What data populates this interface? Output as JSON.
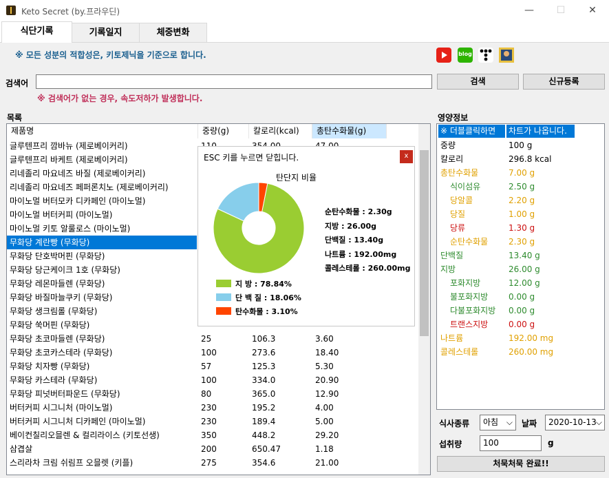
{
  "window": {
    "title": "Keto Secret (by.프라우딘)",
    "controls": {
      "minimize": "—",
      "maximize": "☐",
      "close": "✕"
    }
  },
  "tabs": [
    {
      "label": "식단기록",
      "active": true
    },
    {
      "label": "기록일지",
      "active": false
    },
    {
      "label": "체중변화",
      "active": false
    }
  ],
  "notice": "※ 모든 성분의 적합성은, 키토제닉을 기준으로 합니다.",
  "social_icons": [
    "youtube-icon",
    "blog-icon",
    "tistory-icon",
    "user-photo-icon"
  ],
  "social": {
    "blog_label": "blog"
  },
  "search": {
    "label": "검색어",
    "value": "",
    "search_button": "검색",
    "register_button": "신규등록",
    "warning": "※ 검색어가 없는 경우, 속도저하가 발생합니다."
  },
  "list": {
    "title": "목록",
    "columns": [
      "제품명",
      "중량(g)",
      "칼로리(kcal)",
      "총탄수화물(g)"
    ],
    "sorted_column": 3,
    "selected_row": 7,
    "rows": [
      [
        "글루텐프리 깜바뉴 (제로베이커리)",
        "110",
        "354.00",
        "47.00"
      ],
      [
        "글루텐프리 바케트 (제로베이커리)",
        "",
        "",
        ""
      ],
      [
        "리네졸리 마요네즈 바질 (제로베이커리)",
        "",
        "",
        ""
      ],
      [
        "리네졸리 마요네즈 페퍼론치노 (제로베이커리)",
        "",
        "",
        ""
      ],
      [
        "마이노멀 버터모카 디카페인 (마이노멀)",
        "",
        "",
        ""
      ],
      [
        "마이노멀 버터커피 (마이노멀)",
        "",
        "",
        ""
      ],
      [
        "마이노멀 키토 알룰로스 (마이노멀)",
        "",
        "",
        ""
      ],
      [
        "무화당 계란빵 (무화당)",
        "",
        "",
        ""
      ],
      [
        "무화당 단호박머핀 (무화당)",
        "",
        "",
        ""
      ],
      [
        "무화당 당근케이크 1호 (무화당)",
        "",
        "",
        ""
      ],
      [
        "무화당 레몬마들렌 (무화당)",
        "",
        "",
        ""
      ],
      [
        "무화당 바질마늘쿠키 (무화당)",
        "",
        "",
        ""
      ],
      [
        "무화당 생크림롤 (무화당)",
        "",
        "",
        ""
      ],
      [
        "무화당 쑥머핀 (무화당)",
        "",
        "",
        ""
      ],
      [
        "무화당 초코마들렌 (무화당)",
        "25",
        "106.3",
        "3.60"
      ],
      [
        "무화당 초코카스테라 (무화당)",
        "100",
        "273.6",
        "18.40"
      ],
      [
        "무화당 치자빵 (무화당)",
        "57",
        "125.3",
        "5.30"
      ],
      [
        "무화당 카스테라 (무화당)",
        "100",
        "334.0",
        "20.90"
      ],
      [
        "무화당 피넛버터파운드 (무화당)",
        "80",
        "365.0",
        "12.90"
      ],
      [
        "버터커피 시그니처 (마이노멀)",
        "230",
        "195.2",
        "4.00"
      ],
      [
        "버터커피 시그니처 디카페인 (마이노멀)",
        "230",
        "189.4",
        "5.00"
      ],
      [
        "베이컨칠리오믈렌 & 컬리라이스 (키토선생)",
        "350",
        "448.2",
        "29.20"
      ],
      [
        "삼겹살",
        "200",
        "650.47",
        "1.18"
      ],
      [
        "스리라차 크림 쉬림프 오믈렛 (키플)",
        "275",
        "354.6",
        "21.00"
      ]
    ]
  },
  "popup": {
    "hint": "ESC 키를 누르면 닫힙니다.",
    "close": "x",
    "chart_title": "탄단지 비율",
    "info": [
      "순탄수화물 : 2.30g",
      "지방 : 26.00g",
      "단백질 : 13.40g",
      "나트륨 : 192.00mg",
      "콜레스테롤 : 260.00mg"
    ],
    "legend": [
      {
        "label": "지      방 : 78.84%",
        "color": "#9acd32"
      },
      {
        "label": "단  백  질 : 18.06%",
        "color": "#87ceeb"
      },
      {
        "label": "탄수화물 : 3.10%",
        "color": "#ff4500"
      }
    ]
  },
  "chart_data": {
    "type": "pie",
    "donut": true,
    "title": "탄단지 비율",
    "categories": [
      "지방",
      "단백질",
      "탄수화물"
    ],
    "values": [
      78.84,
      18.06,
      3.1
    ],
    "colors": [
      "#9acd32",
      "#87ceeb",
      "#ff4500"
    ],
    "units": "%",
    "legend_position": "bottom"
  },
  "nutrition": {
    "title": "영양정보",
    "header": [
      "※ 더블클릭하면",
      "차트가 나옵니다."
    ],
    "rows": [
      {
        "name": "중량",
        "value": "100 g",
        "indent": 0,
        "color": "#000000"
      },
      {
        "name": "칼로리",
        "value": "296.8 kcal",
        "indent": 0,
        "color": "#000000"
      },
      {
        "name": "총탄수화물",
        "value": "7.00 g",
        "indent": 0,
        "color": "#e0a000"
      },
      {
        "name": "식이섬유",
        "value": "2.50 g",
        "indent": 1,
        "color": "#2e8b2e"
      },
      {
        "name": "당알콜",
        "value": "2.20 g",
        "indent": 1,
        "color": "#e0a000"
      },
      {
        "name": "당질",
        "value": "1.00 g",
        "indent": 1,
        "color": "#e0a000"
      },
      {
        "name": "당류",
        "value": "1.30 g",
        "indent": 1,
        "color": "#cc1010"
      },
      {
        "name": "순탄수화물",
        "value": "2.30 g",
        "indent": 1,
        "color": "#e0a000"
      },
      {
        "name": "단백질",
        "value": "13.40 g",
        "indent": 0,
        "color": "#2e8b2e"
      },
      {
        "name": "지방",
        "value": "26.00 g",
        "indent": 0,
        "color": "#2e8b2e"
      },
      {
        "name": "포화지방",
        "value": "12.00 g",
        "indent": 1,
        "color": "#2e8b2e"
      },
      {
        "name": "불포화지방",
        "value": "0.00 g",
        "indent": 1,
        "color": "#2e8b2e"
      },
      {
        "name": "다불포화지방",
        "value": "0.00 g",
        "indent": 1,
        "color": "#2e8b2e"
      },
      {
        "name": "트랜스지방",
        "value": "0.00 g",
        "indent": 1,
        "color": "#cc1010"
      },
      {
        "name": "나트륨",
        "value": "192.00 mg",
        "indent": 0,
        "color": "#e0a000"
      },
      {
        "name": "콜레스테롤",
        "value": "260.00 mg",
        "indent": 0,
        "color": "#e0a000"
      }
    ]
  },
  "meal": {
    "type_label": "식사종류",
    "type_value": "아침",
    "date_label": "날짜",
    "date_value": "2020-10-13",
    "intake_label": "섭취량",
    "intake_value": "100",
    "intake_unit": "g",
    "submit_button": "처묵처묵 완료!!"
  },
  "colors": {
    "selection": "#0078d7",
    "sorted_header": "#cce8ff",
    "notice": "#1a5f8f",
    "warning": "#c0305a"
  }
}
